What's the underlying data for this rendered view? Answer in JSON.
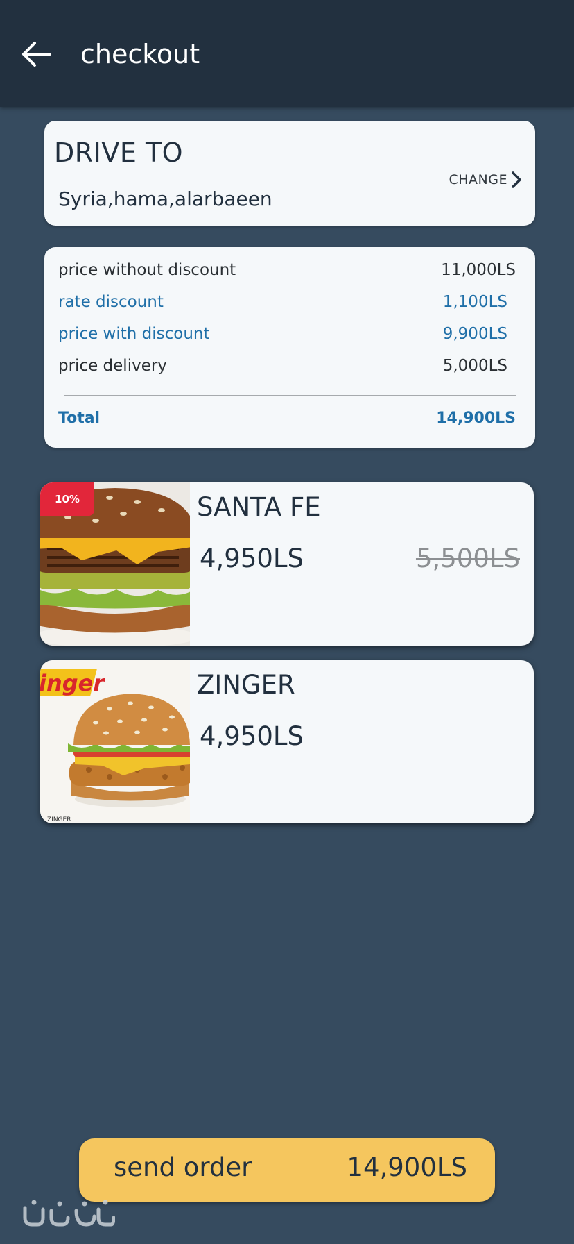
{
  "appbar": {
    "title": "checkout",
    "back_icon": "arrow-left-icon"
  },
  "address": {
    "heading": "DRIVE TO",
    "location": "Syria,hama,alarbaeen",
    "change_label": "CHANGE",
    "change_icon": "chevron-right-icon"
  },
  "summary": {
    "rows": [
      {
        "label": "price without discount",
        "value": "11,000LS"
      },
      {
        "label": "rate discount",
        "value": "1,100LS"
      },
      {
        "label": "price with discount",
        "value": "9,900LS"
      },
      {
        "label": "price delivery",
        "value": "5,000LS"
      }
    ],
    "total_label": "Total",
    "total_value": "14,900LS"
  },
  "products": [
    {
      "name": "SANTA FE",
      "price": "4,950LS",
      "old_price": "5,500LS",
      "badge": "10%"
    },
    {
      "name": "ZINGER",
      "price": "4,950LS",
      "logo_text": "inger",
      "brand_text": "ZINGER"
    }
  ],
  "footer": {
    "send_label": "send order",
    "send_total": "14,900LS"
  },
  "colors": {
    "background": "#364b5f",
    "appbar": "#22303f",
    "card": "#f5f8fa",
    "accent_blue": "#1f6fa8",
    "send_button": "#f5c65e",
    "badge": "#e2263a"
  }
}
